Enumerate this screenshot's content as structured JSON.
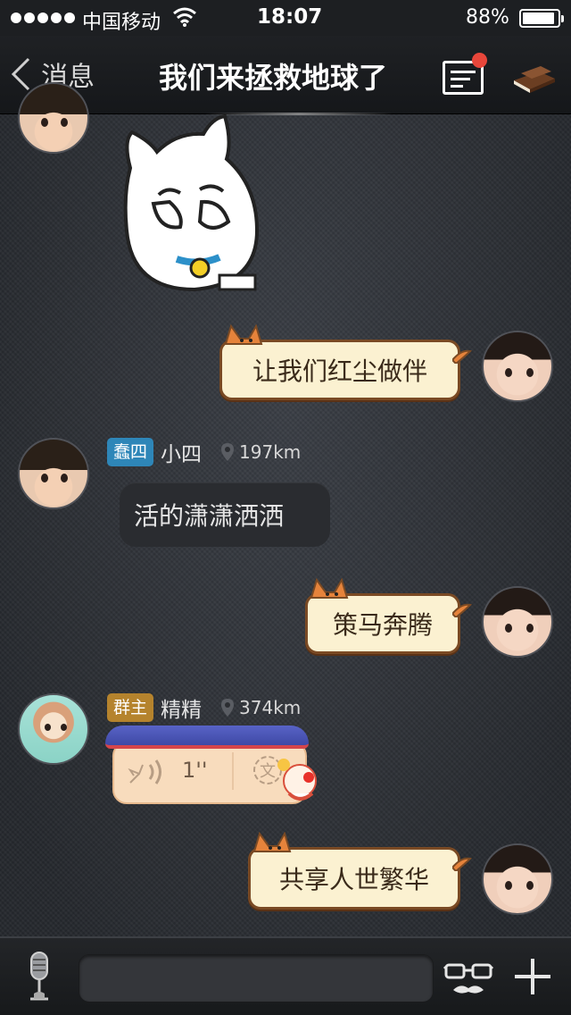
{
  "status_bar": {
    "carrier": "中国移动",
    "time": "18:07",
    "battery": "88%"
  },
  "nav": {
    "back_label": "消息",
    "title": "我们来拯救地球了"
  },
  "messages": [
    {
      "side": "left",
      "type": "sticker",
      "sticker": "cat-rubbing-eyes"
    },
    {
      "side": "right",
      "type": "text",
      "text": "让我们红尘做伴"
    },
    {
      "side": "left",
      "type": "text",
      "badge": "蠢四",
      "name": "小四",
      "distance": "197km",
      "text": "活的潇潇洒洒"
    },
    {
      "side": "right",
      "type": "text",
      "text": "策马奔腾"
    },
    {
      "side": "left",
      "type": "voice",
      "badge": "群主",
      "name": "精精",
      "distance": "374km",
      "duration": "1''",
      "translate_label": "文"
    },
    {
      "side": "right",
      "type": "text",
      "text": "共享人世繁华"
    }
  ],
  "input_bar": {
    "placeholder": ""
  },
  "colors": {
    "badge_blue": "#2e86b8",
    "badge_gold": "#b5832d",
    "bubble_cream": "#fbf1d1",
    "notify_red": "#e8463a"
  }
}
